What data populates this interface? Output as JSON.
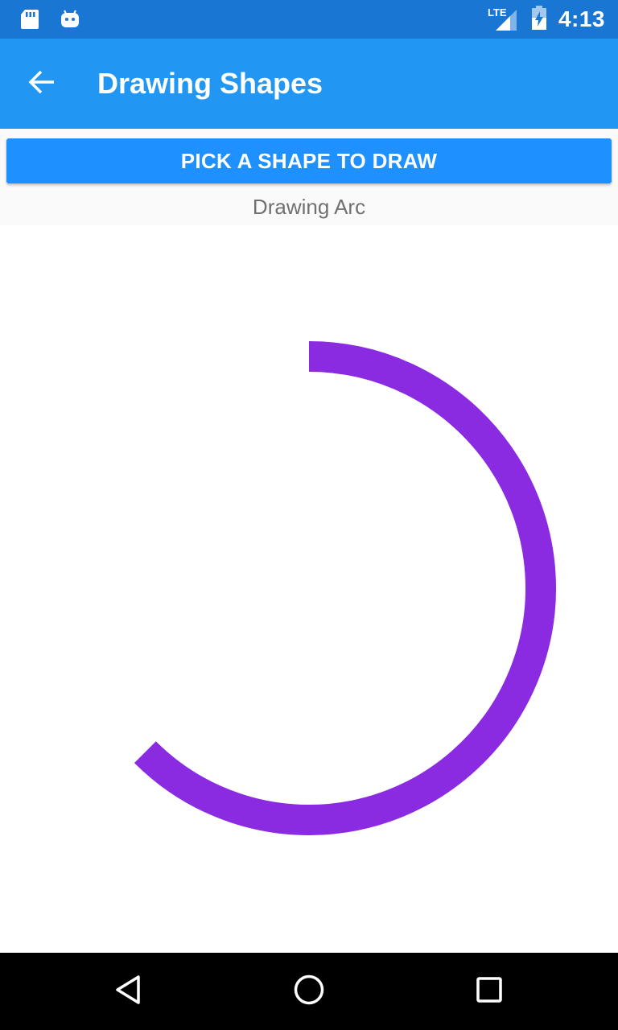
{
  "status_bar": {
    "network": "LTE",
    "time": "4:13",
    "icons": [
      "sd-card-icon",
      "android-icon",
      "signal-icon",
      "battery-icon"
    ]
  },
  "app_bar": {
    "title": "Drawing Shapes",
    "back_icon": "arrow-back-icon"
  },
  "main": {
    "pick_button_label": "PICK A SHAPE TO DRAW",
    "caption": "Drawing Arc",
    "arc": {
      "start_angle_deg": -90,
      "sweep_angle_deg": 225,
      "stroke_color": "#8A2BE2"
    }
  },
  "nav_bar": {
    "icons": [
      "back-triangle-icon",
      "home-circle-icon",
      "recents-square-icon"
    ]
  },
  "colors": {
    "status_bar": "#1976D2",
    "app_bar": "#2196F3",
    "button": "#1E90FF",
    "arc": "#8A2BE2"
  }
}
